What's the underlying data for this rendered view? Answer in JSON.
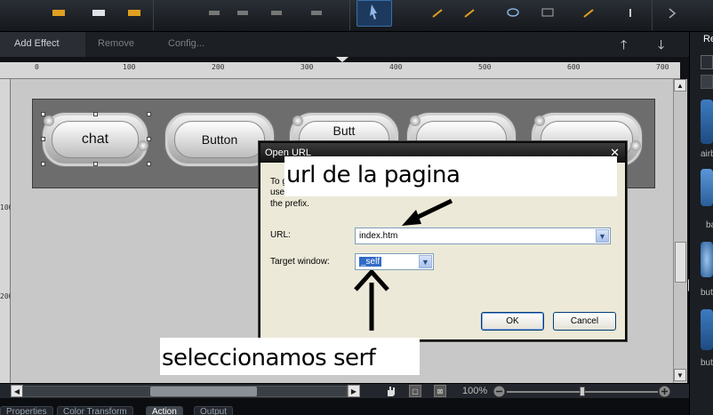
{
  "effect_bar": {
    "add_effect": "Add Effect",
    "remove": "Remove",
    "config": "Config..."
  },
  "ruler": {
    "top_labels": [
      "0",
      "100",
      "200",
      "300",
      "400",
      "500",
      "600",
      "700"
    ],
    "left_labels": [
      "100",
      "200"
    ]
  },
  "buttons": {
    "chat_label": "chat",
    "button_label": "Button",
    "button3_partial": "Butt"
  },
  "dialog": {
    "title": "Open URL",
    "close_glyph": "✕",
    "description_fragment_1": "To g",
    "description_fragment_2": "use",
    "description_fragment_3": "the prefix.",
    "url_label": "URL:",
    "url_value": "index.htm",
    "target_label": "Target window:",
    "target_value": "_self",
    "ok_label": "OK",
    "cancel_label": "Cancel"
  },
  "annotations": {
    "top_note": "url de la  pagina",
    "bottom_note": "seleccionamos serf"
  },
  "statusbar": {
    "zoom": "100%"
  },
  "tabs": [
    "Properties",
    "Color Transform",
    "Action",
    "Output"
  ],
  "active_tab": "Action",
  "right_panel": {
    "title": "Re",
    "labels": [
      "airb",
      "ba",
      "but",
      "butt"
    ]
  },
  "colors": {
    "toolbar_bg": "#1c1f24",
    "canvas_bg": "#c8c8c8",
    "artboard_bg": "#6d6d6d",
    "dialog_bg": "#ece9d8",
    "select_highlight": "#316ac5"
  }
}
